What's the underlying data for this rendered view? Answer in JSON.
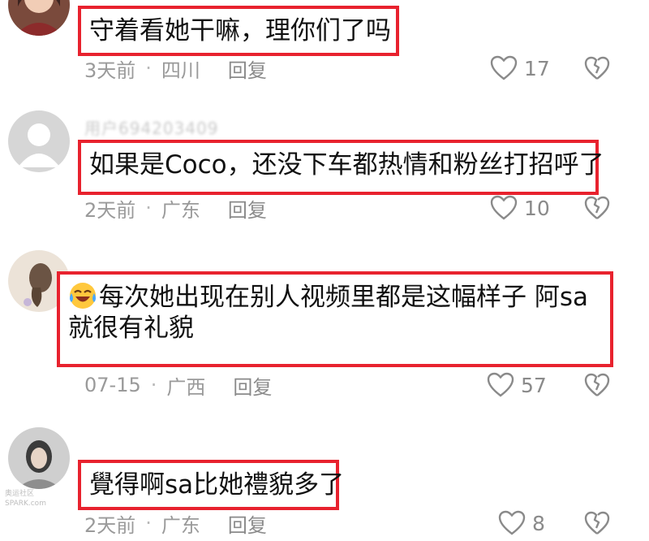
{
  "comments": [
    {
      "username": "",
      "lines": [
        "守着看她干嘛，理你们了吗"
      ],
      "time": "3天前",
      "location": "四川",
      "reply": "回复",
      "likes": "17"
    },
    {
      "username": "用户694203409",
      "lines": [
        "如果是Coco，还没下车都热情和粉丝打招呼了"
      ],
      "time": "2天前",
      "location": "广东",
      "reply": "回复",
      "likes": "10"
    },
    {
      "username": "",
      "lines": [
        "每次她出现在别人视频里都是这幅样子 阿sa",
        "就很有礼貌"
      ],
      "time": "07-15",
      "location": "广西",
      "reply": "回复",
      "likes": "57"
    },
    {
      "username": "",
      "lines": [
        "覺得啊sa比她禮貌多了"
      ],
      "time": "2天前",
      "location": "广东",
      "reply": "回复",
      "likes": "8"
    }
  ],
  "separator": "·",
  "icons": {
    "like": "heart-outline-icon",
    "dislike": "broken-heart-icon",
    "emoji": "laughing-crying-emoji-icon"
  },
  "colors": {
    "highlight_border": "#e8222e",
    "meta_text": "#9a9a9a"
  },
  "watermark": [
    "奥运社区",
    "SPARK.com"
  ]
}
